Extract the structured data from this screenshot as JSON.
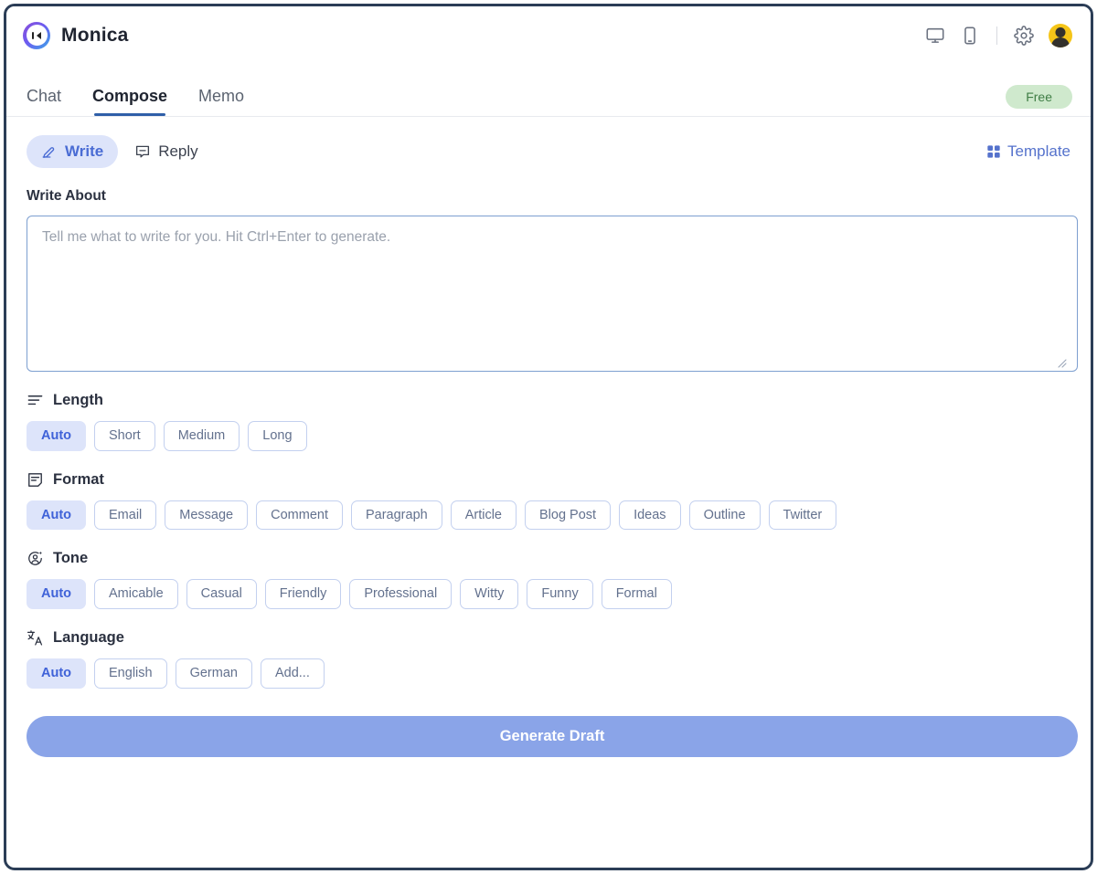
{
  "app": {
    "brand_name": "Monica",
    "logo_icon": "monica-logo-icon"
  },
  "header": {
    "desktop_icon": "desktop-monitor-icon",
    "mobile_icon": "mobile-phone-icon",
    "settings_icon": "gear-icon",
    "avatar_icon": "user-avatar"
  },
  "tabs": {
    "items": [
      {
        "label": "Chat",
        "active": false
      },
      {
        "label": "Compose",
        "active": true
      },
      {
        "label": "Memo",
        "active": false
      }
    ],
    "plan_badge": "Free"
  },
  "mode": {
    "write_label": "Write",
    "write_icon": "pen-write-icon",
    "reply_label": "Reply",
    "reply_icon": "speech-bubble-reply-icon",
    "selected": "Write",
    "template_label": "Template",
    "template_icon": "grid-squares-icon"
  },
  "write_about": {
    "label": "Write About",
    "placeholder": "Tell me what to write for you. Hit Ctrl+Enter to generate.",
    "value": ""
  },
  "options": {
    "length": {
      "title": "Length",
      "icon": "text-lines-icon",
      "selected": "Auto",
      "choices": [
        "Auto",
        "Short",
        "Medium",
        "Long"
      ]
    },
    "format": {
      "title": "Format",
      "icon": "document-format-icon",
      "selected": "Auto",
      "choices": [
        "Auto",
        "Email",
        "Message",
        "Comment",
        "Paragraph",
        "Article",
        "Blog Post",
        "Ideas",
        "Outline",
        "Twitter"
      ]
    },
    "tone": {
      "title": "Tone",
      "icon": "person-sparkle-icon",
      "selected": "Auto",
      "choices": [
        "Auto",
        "Amicable",
        "Casual",
        "Friendly",
        "Professional",
        "Witty",
        "Funny",
        "Formal"
      ]
    },
    "language": {
      "title": "Language",
      "icon": "translate-icon",
      "selected": "Auto",
      "choices": [
        "Auto",
        "English",
        "German",
        "Add..."
      ]
    }
  },
  "actions": {
    "generate_label": "Generate Draft"
  },
  "colors": {
    "accent_blue": "#4a6cd4",
    "chip_selected_bg": "#dde4fa",
    "chip_border": "#c3d0ef",
    "generate_bg": "#8aa4e8",
    "badge_bg": "#cfe9cd",
    "badge_text": "#3f7d45",
    "tab_underline": "#2f5fa8",
    "window_border": "#2b3d56"
  }
}
